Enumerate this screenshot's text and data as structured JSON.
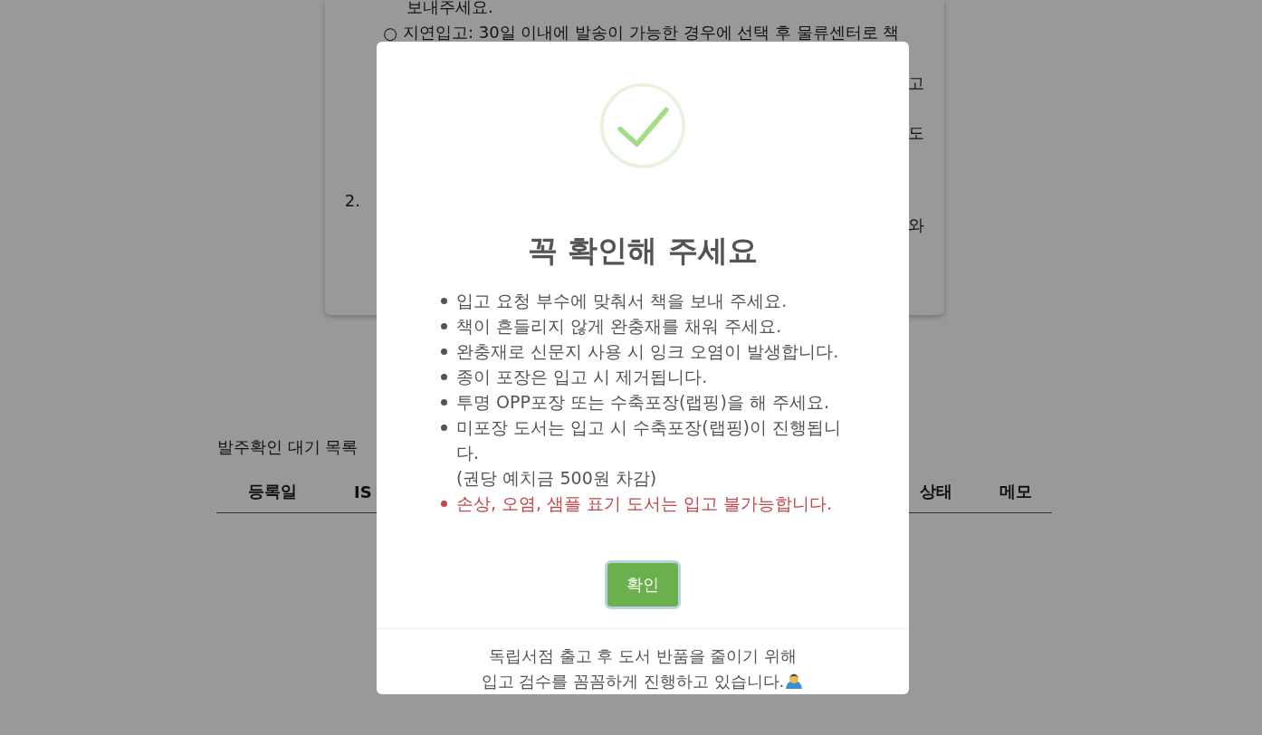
{
  "background": {
    "card_lines": [
      {
        "text": "보내주세요."
      },
      {
        "marker": "○",
        "text": "지연입고: 30일 이내에 발송이 가능한 경우에 선택 후 물류센터로 책"
      },
      {
        "edge": "고"
      },
      {
        "edge": "도"
      },
      {
        "marker": "2."
      },
      {
        "edge": "와"
      }
    ],
    "section_title": "발주확인 대기 목록",
    "table": {
      "columns": [
        "등록일",
        "IS",
        "상태",
        "메모"
      ]
    }
  },
  "modal": {
    "title": "꼭 확인해 주세요",
    "items": [
      {
        "text": "입고 요청 부수에 맞춰서 책을 보내 주세요.",
        "color": "#545454"
      },
      {
        "text": "책이 흔들리지 않게 완충재를 채워 주세요.",
        "color": "#545454"
      },
      {
        "text": "완충재로 신문지 사용 시 잉크 오염이 발생합니다.",
        "color": "#545454"
      },
      {
        "text": "종이 포장은 입고 시 제거됩니다.",
        "color": "#545454"
      },
      {
        "text": "투명 OPP포장 또는 수축포장(랩핑)을 해 주세요.",
        "color": "#545454"
      },
      {
        "text": "미포장 도서는 입고 시 수축포장(랩핑)이 진행됩니다.\n(권당 예치금 500원 차감)",
        "color": "#545454"
      },
      {
        "text": "손상, 오염, 샘플 표기 도서는 입고 불가능합니다.",
        "color": "#c4474b"
      }
    ],
    "confirm_button": "확인",
    "footer": [
      "독립서점 출고 후 도서 반품을 줄이기 위해",
      "입고 검수를 꼼꼼하게 진행하고 있습니다."
    ]
  }
}
